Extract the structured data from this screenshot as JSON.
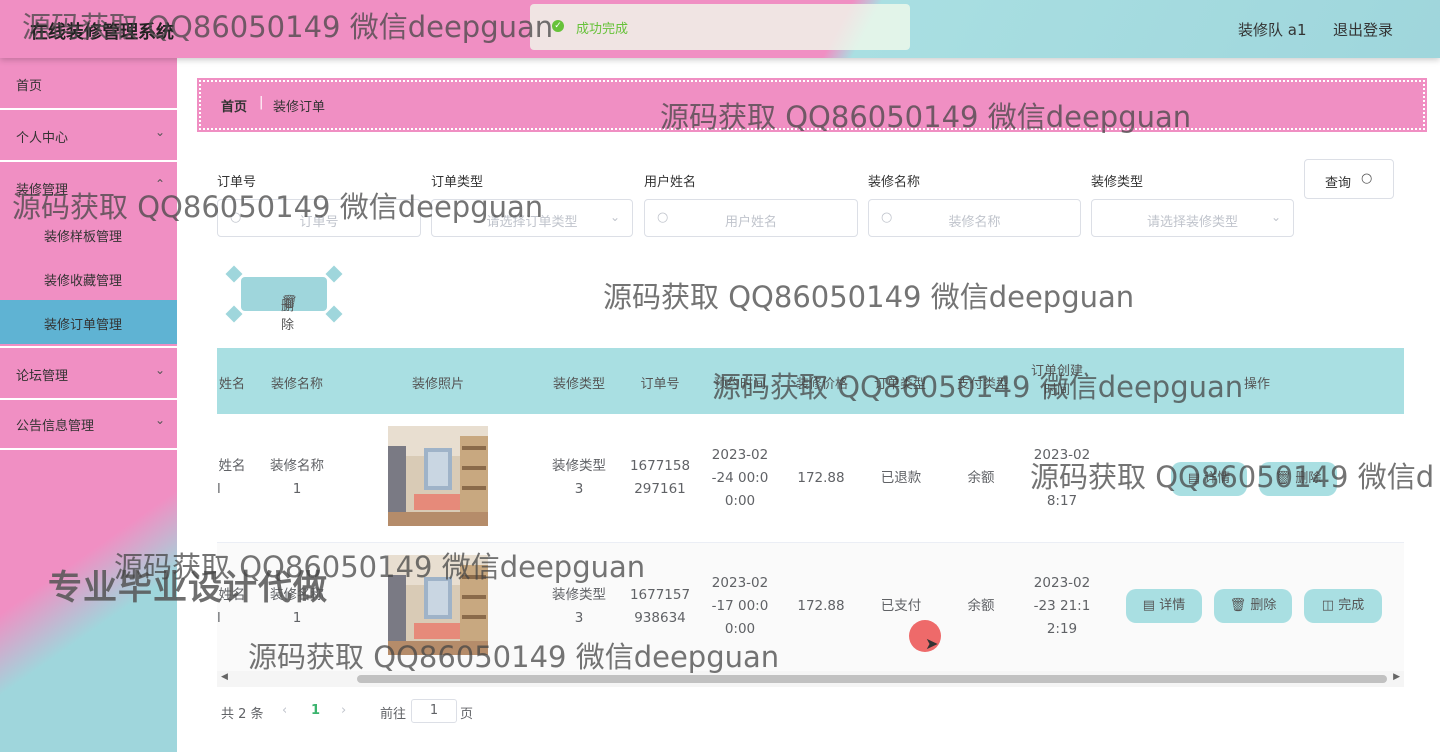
{
  "app": {
    "title": "在线装修管理系统",
    "user": "装修队 a1",
    "logout": "退出登录"
  },
  "toast": {
    "text": "成功完成"
  },
  "sidebar": {
    "items": [
      {
        "label": "首页"
      },
      {
        "label": "个人中心"
      },
      {
        "label": "装修管理"
      },
      {
        "label": "论坛管理"
      },
      {
        "label": "公告信息管理"
      }
    ],
    "sub_items": [
      {
        "label": "装修样板管理"
      },
      {
        "label": "装修收藏管理"
      },
      {
        "label": "装修订单管理"
      }
    ]
  },
  "breadcrumb": {
    "home": "首页",
    "separator": "|",
    "current": "装修订单"
  },
  "filters": {
    "order_no": {
      "label": "订单号",
      "placeholder": "订单号"
    },
    "order_type": {
      "label": "订单类型",
      "placeholder": "请选择订单类型"
    },
    "user_name": {
      "label": "用户姓名",
      "placeholder": "用户姓名"
    },
    "deco_name": {
      "label": "装修名称",
      "placeholder": "装修名称"
    },
    "deco_type": {
      "label": "装修类型",
      "placeholder": "请选择装修类型"
    },
    "query_label": "查询"
  },
  "toolbar": {
    "delete_label": "删除"
  },
  "table": {
    "headers": [
      "姓名",
      "装修名称",
      "装修照片",
      "装修类型",
      "订单号",
      "预约时间",
      "装修价格",
      "订单类型",
      "支付类型",
      "订单创建时间",
      "操作"
    ],
    "rows": [
      {
        "name": "姓名",
        "name2": "l",
        "deco_name": "装修名称",
        "deco_name2": "1",
        "deco_type": "装修类型",
        "deco_type2": "3",
        "order_no": "1677158",
        "order_no2": "297161",
        "appoint1": "2023-02",
        "appoint2": "-24 00:0",
        "appoint3": "0:00",
        "price": "172.88",
        "order_type": "已退款",
        "pay_type": "余额",
        "created1": "2023-02",
        "created2": "",
        "created3": "8:17",
        "ops": [
          "详情",
          "删除"
        ]
      },
      {
        "name": "姓名",
        "name2": "l",
        "deco_name": "装修名称",
        "deco_name2": "1",
        "deco_type": "装修类型",
        "deco_type2": "3",
        "order_no": "1677157",
        "order_no2": "938634",
        "appoint1": "2023-02",
        "appoint2": "-17 00:0",
        "appoint3": "0:00",
        "price": "172.88",
        "order_type": "已支付",
        "pay_type": "余额",
        "created1": "2023-02",
        "created2": "-23 21:1",
        "created3": "2:19",
        "ops": [
          "详情",
          "删除",
          "完成"
        ]
      }
    ]
  },
  "pagination": {
    "total": "共 2 条",
    "current": "1",
    "goto": "前往",
    "goto_value": "1",
    "page_suffix": "页"
  },
  "overlays": {
    "watermark": "源码获取 QQ86050149 微信deepguan",
    "watermark_cut": "源码获取 QQ86050149 微信d",
    "promo": "专业毕业设计代做"
  },
  "colors": {
    "pink": "#f08fc3",
    "teal": "#a9dfe2",
    "active_blue": "#5fb3d3",
    "success": "#67c23a"
  }
}
